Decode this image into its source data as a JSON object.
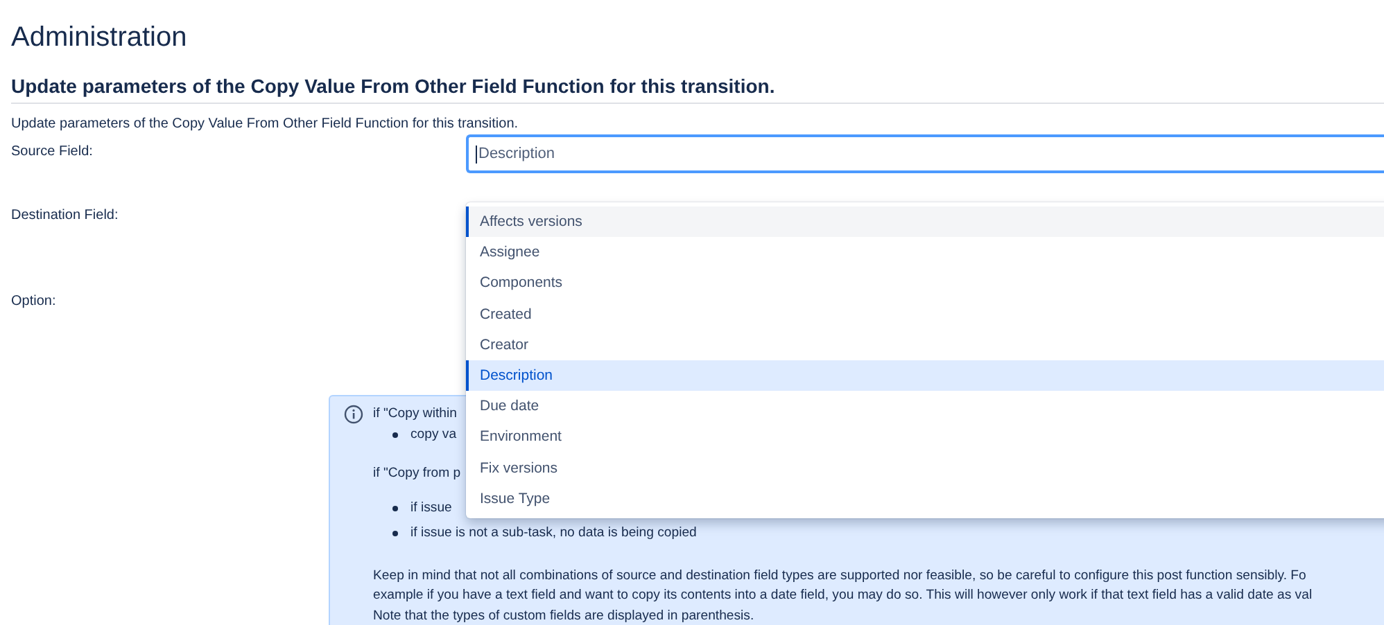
{
  "page_title": "Administration",
  "section": {
    "heading": "Update parameters of the Copy Value From Other Field Function for this transition.",
    "description": "Update parameters of the Copy Value From Other Field Function for this transition."
  },
  "form": {
    "fields": [
      {
        "label": "Source Field:",
        "kind": "select",
        "value": "Description"
      },
      {
        "label": "Destination Field:",
        "kind": "empty"
      },
      {
        "label": "Option:",
        "kind": "empty"
      }
    ]
  },
  "dropdown": {
    "options": [
      {
        "label": "Affects versions",
        "selected": false,
        "focused": true
      },
      {
        "label": "Assignee",
        "selected": false,
        "focused": false
      },
      {
        "label": "Components",
        "selected": false,
        "focused": false
      },
      {
        "label": "Created",
        "selected": false,
        "focused": false
      },
      {
        "label": "Creator",
        "selected": false,
        "focused": false
      },
      {
        "label": "Description",
        "selected": true,
        "focused": false
      },
      {
        "label": "Due date",
        "selected": false,
        "focused": false
      },
      {
        "label": "Environment",
        "selected": false,
        "focused": false
      },
      {
        "label": "Fix versions",
        "selected": false,
        "focused": false
      },
      {
        "label": "Issue Type",
        "selected": false,
        "focused": false
      }
    ]
  },
  "info": {
    "blocks": [
      {
        "kind": "line",
        "text": "if \"Copy within"
      },
      {
        "kind": "bullets",
        "items": [
          "copy va"
        ]
      },
      {
        "kind": "line",
        "text": "if \"Copy from p"
      },
      {
        "kind": "bullets",
        "items": [
          "if issue",
          "if issue is not a sub-task, no data is being copied"
        ]
      },
      {
        "kind": "paragraph",
        "lines": [
          "Keep in mind that not all combinations of source and destination field types are supported nor feasible, so be careful to configure this post function sensibly. Fo",
          "example if you have a text field and want to copy its contents into a date field, you may do so. This will however only work if that text field has a valid date as val",
          "Note that the types of custom fields are displayed in parenthesis."
        ]
      }
    ]
  }
}
